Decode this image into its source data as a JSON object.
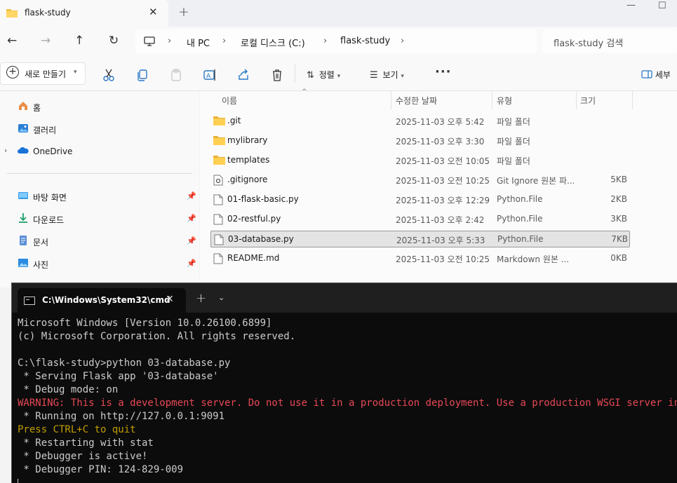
{
  "explorer": {
    "tab_title": "flask-study",
    "breadcrumb": [
      "내 PC",
      "로컬 디스크 (C:)",
      "flask-study"
    ],
    "search_placeholder": "flask-study 검색",
    "toolbar": {
      "new_label": "새로 만들기",
      "sort_label": "정렬",
      "view_label": "보기",
      "more_label": "···",
      "details_label": "세부"
    },
    "sidebar": {
      "items": [
        {
          "label": "홈",
          "icon": "home-icon"
        },
        {
          "label": "갤러리",
          "icon": "gallery-icon"
        },
        {
          "label": "OneDrive",
          "icon": "onedrive-icon"
        },
        {
          "label": "바탕 화면",
          "icon": "desktop-icon",
          "pinned": true
        },
        {
          "label": "다운로드",
          "icon": "download-icon",
          "pinned": true
        },
        {
          "label": "문서",
          "icon": "documents-icon",
          "pinned": true
        },
        {
          "label": "사진",
          "icon": "pictures-icon",
          "pinned": true
        }
      ]
    },
    "columns": {
      "name": "이름",
      "date": "수정한 날짜",
      "type": "유형",
      "size": "크기"
    },
    "files": [
      {
        "name": ".git",
        "date": "2025-11-03 오후 5:42",
        "type": "파일 폴더",
        "size": "",
        "kind": "folder"
      },
      {
        "name": "mylibrary",
        "date": "2025-11-03 오후 3:30",
        "type": "파일 폴더",
        "size": "",
        "kind": "folder"
      },
      {
        "name": "templates",
        "date": "2025-11-03 오전 10:05",
        "type": "파일 폴더",
        "size": "",
        "kind": "folder"
      },
      {
        "name": ".gitignore",
        "date": "2025-11-03 오전 10:25",
        "type": "Git Ignore 원본 파...",
        "size": "5KB",
        "kind": "gear-file"
      },
      {
        "name": "01-flask-basic.py",
        "date": "2025-11-03 오후 12:29",
        "type": "Python.File",
        "size": "2KB",
        "kind": "file"
      },
      {
        "name": "02-restful.py",
        "date": "2025-11-03 오후 2:42",
        "type": "Python.File",
        "size": "3KB",
        "kind": "file"
      },
      {
        "name": "03-database.py",
        "date": "2025-11-03 오후 5:33",
        "type": "Python.File",
        "size": "7KB",
        "kind": "file",
        "selected": true
      },
      {
        "name": "README.md",
        "date": "2025-11-03 오전 10:25",
        "type": "Markdown 원본 ...",
        "size": "0KB",
        "kind": "file"
      }
    ]
  },
  "terminal": {
    "tab_title": "C:\\Windows\\System32\\cmd",
    "lines": [
      {
        "text": "Microsoft Windows [Version 10.0.26100.6899]",
        "style": "normal"
      },
      {
        "text": "(c) Microsoft Corporation. All rights reserved.",
        "style": "normal"
      },
      {
        "text": "",
        "style": "normal"
      },
      {
        "text": "C:\\flask-study>python 03-database.py",
        "style": "normal"
      },
      {
        "text": " * Serving Flask app '03-database'",
        "style": "normal"
      },
      {
        "text": " * Debug mode: on",
        "style": "normal"
      },
      {
        "text": "WARNING: This is a development server. Do not use it in a production deployment. Use a production WSGI server instead.",
        "style": "warn"
      },
      {
        "text": " * Running on http://127.0.0.1:9091",
        "style": "normal"
      },
      {
        "text": "Press CTRL+C to quit",
        "style": "yel"
      },
      {
        "text": " * Restarting with stat",
        "style": "normal"
      },
      {
        "text": " * Debugger is active!",
        "style": "normal"
      },
      {
        "text": " * Debugger PIN: 124-829-009",
        "style": "normal"
      }
    ]
  }
}
